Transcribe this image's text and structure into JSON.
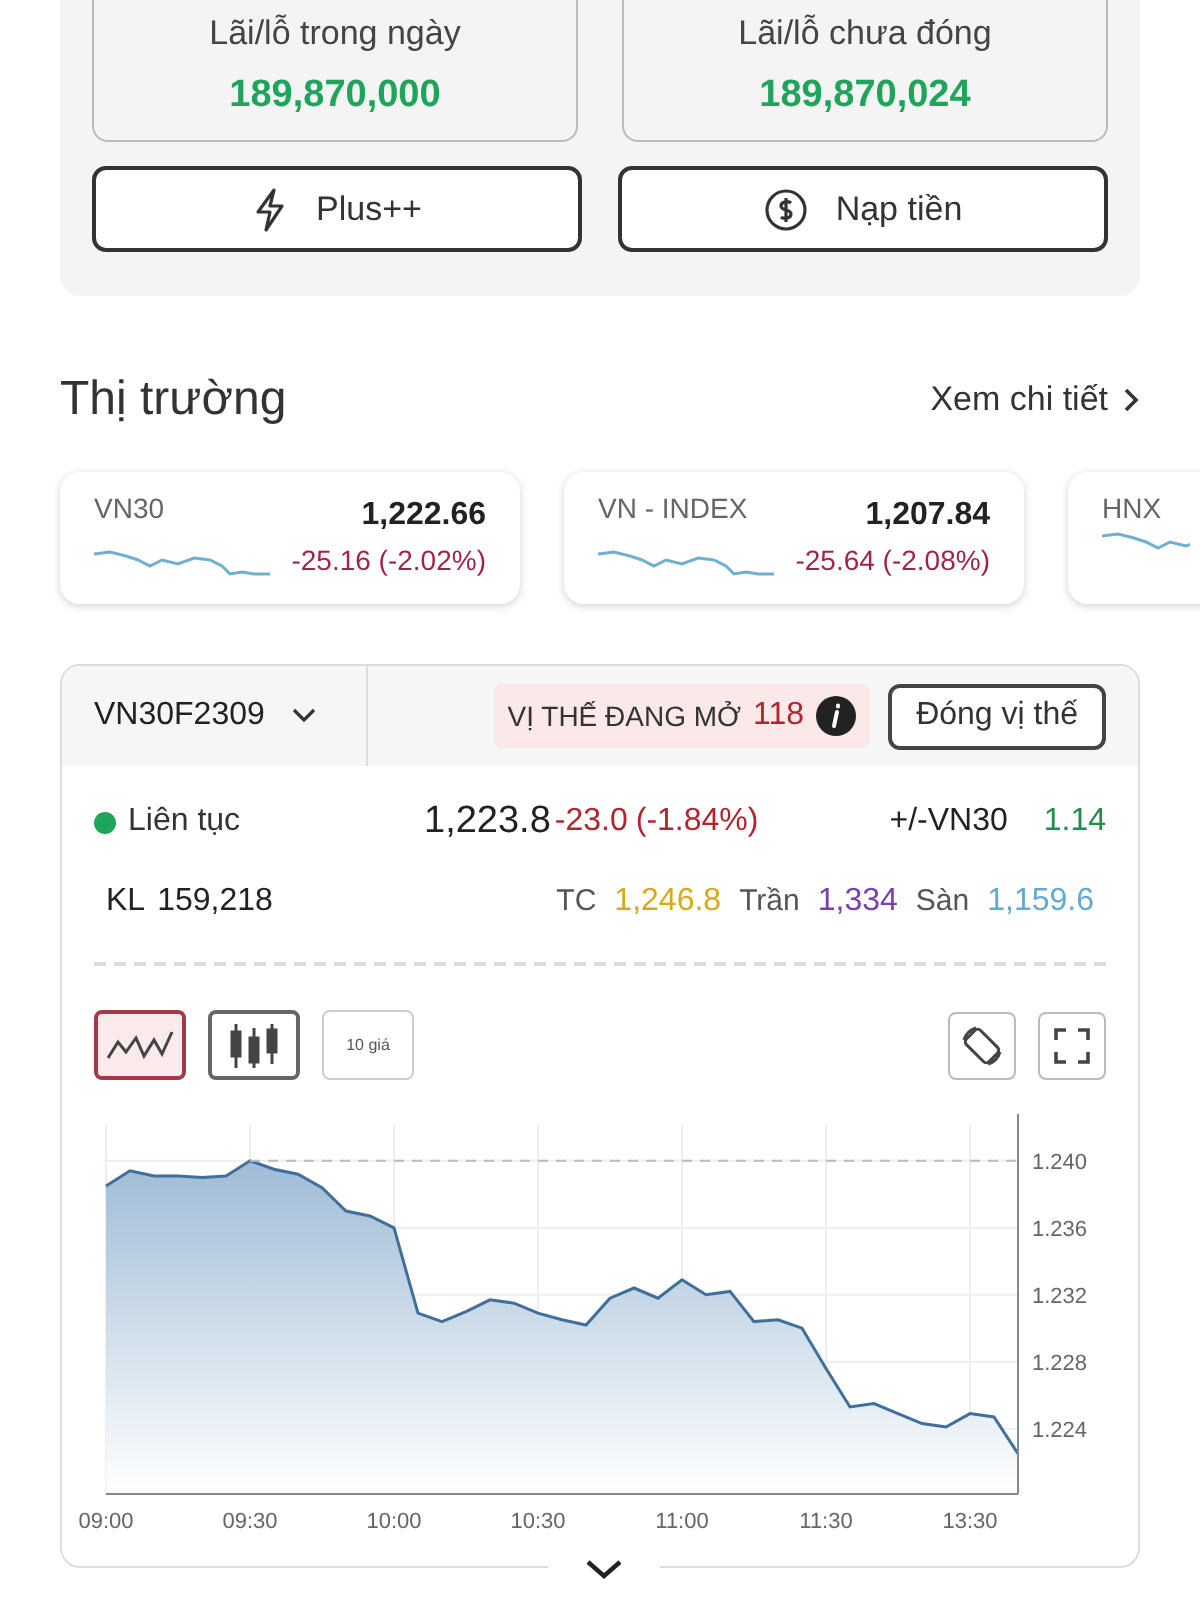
{
  "summary": {
    "stats": [
      {
        "label": "Lãi/lỗ trong ngày",
        "value": "189,870,000"
      },
      {
        "label": "Lãi/lỗ chưa đóng",
        "value": "189,870,024"
      }
    ],
    "buttons": [
      {
        "kind": "plus",
        "label": "Plus++"
      },
      {
        "kind": "deposit",
        "label": "Nạp tiền"
      }
    ]
  },
  "market": {
    "title": "Thị trường",
    "link": "Xem chi tiết",
    "indices": [
      {
        "name": "VN30",
        "value": "1,222.66",
        "change": "-25.16 (-2.02%)"
      },
      {
        "name": "VN - INDEX",
        "value": "1,207.84",
        "change": "-25.64 (-2.08%)"
      },
      {
        "name": "HNX"
      }
    ]
  },
  "instrument": {
    "symbol": "VN30F2309",
    "open_positions": {
      "label": "VỊ THẾ ĐANG MỞ",
      "count": "118"
    },
    "close_button": "Đóng vị thế",
    "status": "Liên tục",
    "price": "1,223.8",
    "change": "-23.0",
    "percent": "(-1.84%)",
    "basis_label": "+/-VN30",
    "basis_value": "1.14",
    "volume_label": "KL",
    "volume": "159,218",
    "refs": [
      {
        "label": "TC",
        "value": "1,246.8",
        "color": "#d9a91a"
      },
      {
        "label": "Trần",
        "value": "1,334",
        "color": "#7b3fb0"
      },
      {
        "label": "Sàn",
        "value": "1,159.6",
        "color": "#62a9d4"
      }
    ],
    "chart_types": [
      {
        "kind": "line",
        "selected": true
      },
      {
        "kind": "candle",
        "selected": false
      },
      {
        "kind": "depth",
        "label": "10 giá",
        "selected": false
      }
    ],
    "chart_data": {
      "type": "area",
      "categories": [
        "09:00",
        null,
        null,
        null,
        null,
        null,
        "09:30",
        null,
        null,
        null,
        null,
        null,
        "10:00",
        null,
        null,
        null,
        null,
        null,
        "10:30",
        null,
        null,
        null,
        null,
        null,
        "11:00",
        null,
        null,
        null,
        null,
        null,
        "11:30",
        null,
        null,
        null,
        null,
        null,
        "13:30",
        null,
        null
      ],
      "series": [
        {
          "color": "#3f6f9a",
          "values": [
            1.2385,
            1.2394,
            1.2391,
            1.2391,
            1.239,
            1.2391,
            1.24,
            1.2395,
            1.2392,
            1.2384,
            1.237,
            1.2367,
            1.236,
            1.2309,
            1.2304,
            1.231,
            1.2317,
            1.2315,
            1.2309,
            1.2305,
            1.2302,
            1.2318,
            1.2324,
            1.2318,
            1.2329,
            1.232,
            1.2322,
            1.2304,
            1.2305,
            1.23,
            1.2276,
            1.2253,
            1.2255,
            1.2249,
            1.2243,
            1.2241,
            1.2249,
            1.2247,
            1.2225
          ]
        }
      ],
      "ylim": [
        1.2201,
        1.2422
      ],
      "grid": true,
      "ref_lines": [
        {
          "axis": "y",
          "value": 1.24
        }
      ],
      "yticks": [
        {
          "value": 1.224,
          "label": "1.224"
        },
        {
          "value": 1.228,
          "label": "1.228"
        },
        {
          "value": 1.232,
          "label": "1.232"
        },
        {
          "value": 1.236,
          "label": "1.236"
        },
        {
          "value": 1.24,
          "label": "1.240"
        }
      ]
    },
    "expand": {
      "expanded": false
    }
  }
}
